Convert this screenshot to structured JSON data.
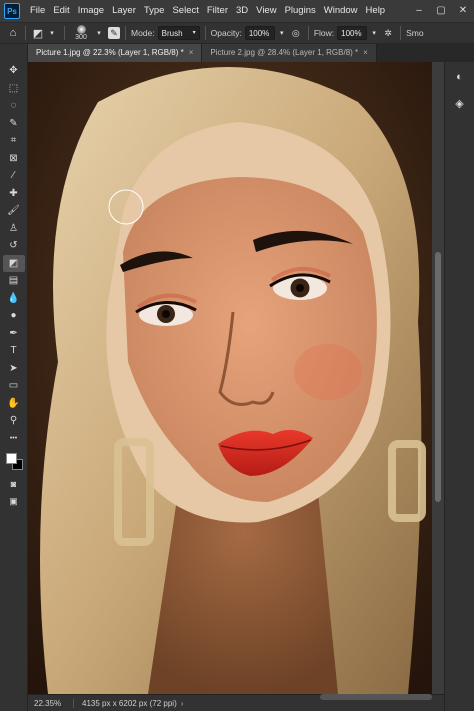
{
  "app": {
    "logo": "Ps"
  },
  "menu": [
    "File",
    "Edit",
    "Image",
    "Layer",
    "Type",
    "Select",
    "Filter",
    "3D",
    "View",
    "Plugins",
    "Window",
    "Help"
  ],
  "window_controls": [
    "–",
    "▢",
    "✕"
  ],
  "options": {
    "brush_size": "300",
    "mode_label": "Mode:",
    "mode_value": "Brush",
    "opacity_label": "Opacity:",
    "opacity_value": "100%",
    "flow_label": "Flow:",
    "flow_value": "100%",
    "smoothing_label": "Smo"
  },
  "tabs": [
    {
      "label": "Picture 1.jpg @ 22.3% (Layer 1, RGB/8) *",
      "close": "×",
      "active": true
    },
    {
      "label": "Picture 2.jpg @ 28.4% (Layer 1, RGB/8) *",
      "close": "×",
      "active": false
    }
  ],
  "tools": [
    {
      "name": "move-icon",
      "glyph": "✥"
    },
    {
      "name": "marquee-icon",
      "glyph": "⬚"
    },
    {
      "name": "lasso-icon",
      "glyph": "◌"
    },
    {
      "name": "quick-select-icon",
      "glyph": "✎"
    },
    {
      "name": "crop-icon",
      "glyph": "⌗"
    },
    {
      "name": "frame-icon",
      "glyph": "⊠"
    },
    {
      "name": "eyedropper-icon",
      "glyph": "⁄"
    },
    {
      "name": "healing-brush-icon",
      "glyph": "✚"
    },
    {
      "name": "brush-icon",
      "glyph": "🖌"
    },
    {
      "name": "clone-stamp-icon",
      "glyph": "♙"
    },
    {
      "name": "history-brush-icon",
      "glyph": "↺"
    },
    {
      "name": "eraser-icon",
      "glyph": "◩"
    },
    {
      "name": "gradient-icon",
      "glyph": "▤"
    },
    {
      "name": "blur-icon",
      "glyph": "💧"
    },
    {
      "name": "dodge-icon",
      "glyph": "●"
    },
    {
      "name": "pen-icon",
      "glyph": "✒"
    },
    {
      "name": "type-icon",
      "glyph": "T"
    },
    {
      "name": "path-select-icon",
      "glyph": "➤"
    },
    {
      "name": "rectangle-icon",
      "glyph": "▭"
    },
    {
      "name": "hand-icon",
      "glyph": "✋"
    },
    {
      "name": "zoom-icon",
      "glyph": "⚲"
    },
    {
      "name": "more-tools-icon",
      "glyph": "•••"
    }
  ],
  "active_tool": "eraser-icon",
  "right_panel": [
    {
      "name": "color-panel-icon",
      "glyph": "◐"
    },
    {
      "name": "layers-panel-icon",
      "glyph": "◈"
    }
  ],
  "status": {
    "zoom": "22.35%",
    "dimensions": "4135 px x 6202 px (72 ppi)",
    "arrow": "›"
  },
  "colors": {
    "foreground": "#ffffff",
    "background": "#000000",
    "accent": "#31a8ff"
  }
}
